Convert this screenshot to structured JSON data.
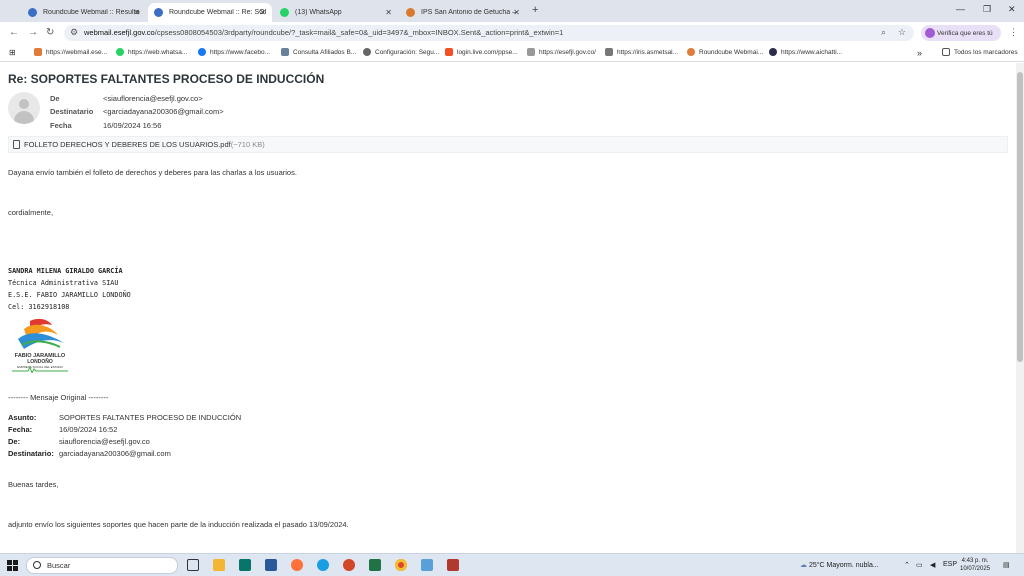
{
  "browser": {
    "tabs": [
      {
        "title": "Roundcube Webmail :: Resultado",
        "active": false,
        "color": "#3a6fc5"
      },
      {
        "title": "Roundcube Webmail :: Re: SOPORTES",
        "active": true,
        "color": "#3a6fc5"
      },
      {
        "title": "(13) WhatsApp",
        "active": false,
        "color": "#25d366"
      },
      {
        "title": "IPS San Antonio de Getucha – ",
        "active": false,
        "color": "#d77a2d"
      }
    ],
    "url_host": "webmail.esefjl.gov.co",
    "url_path": "/cpsess0808054503/3rdparty/roundcube/?_task=mail&_safe=0&_uid=3497&_mbox=INBOX.Sent&_action=print&_extwin=1",
    "profile_label": "Verifica que eres tú",
    "bookmarks": [
      {
        "label": "https://webmail.ese...",
        "color": "#e07b39"
      },
      {
        "label": "https://web.whatsa...",
        "color": "#25d366"
      },
      {
        "label": "https://www.facebo...",
        "color": "#1877f2"
      },
      {
        "label": "Consulta Afiliados B...",
        "color": "#6a7f99"
      },
      {
        "label": "Configuración: Segu...",
        "color": "#666666"
      },
      {
        "label": "login.live.com/ppse...",
        "color": "#f25022"
      },
      {
        "label": "https://esefjl.gov.co/",
        "color": "#999999"
      },
      {
        "label": "https://iris.asmetsal...",
        "color": "#777777"
      },
      {
        "label": "Roundcube Webmai...",
        "color": "#e07b39"
      },
      {
        "label": "https://www.aichatti...",
        "color": "#2b2b4a"
      }
    ],
    "bookmarks_folder": "Todos los marcadores"
  },
  "email": {
    "subject": "Re: SOPORTES FALTANTES PROCESO DE INDUCCIÓN",
    "headers": [
      {
        "label": "De",
        "value": "<siauflorencia@esefjl.gov.co>"
      },
      {
        "label": "Destinatario",
        "value": "<garciadayana200306@gmail.com>"
      },
      {
        "label": "Fecha",
        "value": "16/09/2024 16:56"
      }
    ],
    "attachment_name": "FOLLETO DERECHOS Y DEBERES DE LOS USUARIOS.pdf",
    "attachment_size": "(~710 KB)",
    "body_line1": "Dayana envío también el folleto de derechos y deberes para las charlas a los usuarios.",
    "closing": "cordialmente,",
    "signature": [
      "SANDRA MILENA GIRALDO GARCÍA",
      "Técnica Administrativa SIAU",
      "E.S.E. FABIO JARAMILLO LONDOÑO",
      "Cel: 3162918108"
    ],
    "logo_text1": "FABIO JARAMILLO",
    "logo_text2": "LONDOÑO",
    "logo_text3": "EMPRESA SOCIAL DEL ESTADO",
    "forward_header": "-------- Mensaje Original --------",
    "forward": [
      {
        "label": "Asunto:",
        "value": "SOPORTES FALTANTES PROCESO DE INDUCCIÓN"
      },
      {
        "label": "Fecha:",
        "value": "16/09/2024 16:52"
      },
      {
        "label": "De:",
        "value": "siauflorencia@esefjl.gov.co"
      },
      {
        "label": "Destinatario:",
        "value": "garciadayana200306@gmail.com"
      }
    ],
    "greeting": "Buenas tardes,",
    "body_line2": "adjunto envío los siguientes soportes que hacen parte de la inducción realizada el pasado 13/09/2024."
  },
  "taskbar": {
    "search_placeholder": "Buscar",
    "weather": "25°C  Mayorm. nubla...",
    "lang": "ESP",
    "time": "4:43 p. m.",
    "date": "10/07/2025"
  }
}
